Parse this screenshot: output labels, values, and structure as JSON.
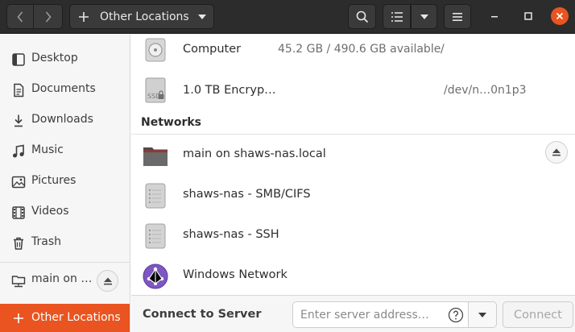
{
  "window": {
    "location_label": "Other Locations",
    "accent_color": "#e95420"
  },
  "header": {
    "icons": [
      "go-back-icon",
      "go-forward-icon",
      "new-location-plus-icon",
      "path-dropdown-icon",
      "search-icon",
      "list-view-icon",
      "view-options-dropdown-icon",
      "hamburger-menu-icon",
      "minimize-icon",
      "maximize-icon",
      "close-icon"
    ]
  },
  "sidebar": {
    "items": [
      {
        "label": "Desktop",
        "icon": "desktop-icon"
      },
      {
        "label": "Documents",
        "icon": "documents-icon"
      },
      {
        "label": "Downloads",
        "icon": "downloads-icon"
      },
      {
        "label": "Music",
        "icon": "music-icon"
      },
      {
        "label": "Pictures",
        "icon": "pictures-icon"
      },
      {
        "label": "Videos",
        "icon": "videos-icon"
      },
      {
        "label": "Trash",
        "icon": "trash-icon"
      }
    ],
    "mount": {
      "label": "main on …",
      "icon": "network-folder-icon"
    },
    "other_locations": {
      "label": "Other Locations",
      "icon": "plus-icon"
    }
  },
  "main": {
    "devices": [
      {
        "name": "Computer",
        "info": "45.2 GB / 490.6 GB available",
        "path": "/",
        "icon": "hard-drive-icon"
      },
      {
        "name": "1.0 TB Encryp…",
        "info": "",
        "path": "/dev/n…0n1p3",
        "icon": "ssd-locked-icon"
      }
    ],
    "networks_heading": "Networks",
    "networks": [
      {
        "name": "main on shaws-nas.local",
        "icon": "network-folder-icon"
      },
      {
        "name": "shaws-nas - SMB/CIFS",
        "icon": "network-server-icon"
      },
      {
        "name": "shaws-nas - SSH",
        "icon": "network-server-icon"
      },
      {
        "name": "Windows Network",
        "icon": "windows-network-icon"
      }
    ]
  },
  "connect": {
    "label": "Connect to Server",
    "placeholder": "Enter server address…",
    "button_label": "Connect"
  }
}
